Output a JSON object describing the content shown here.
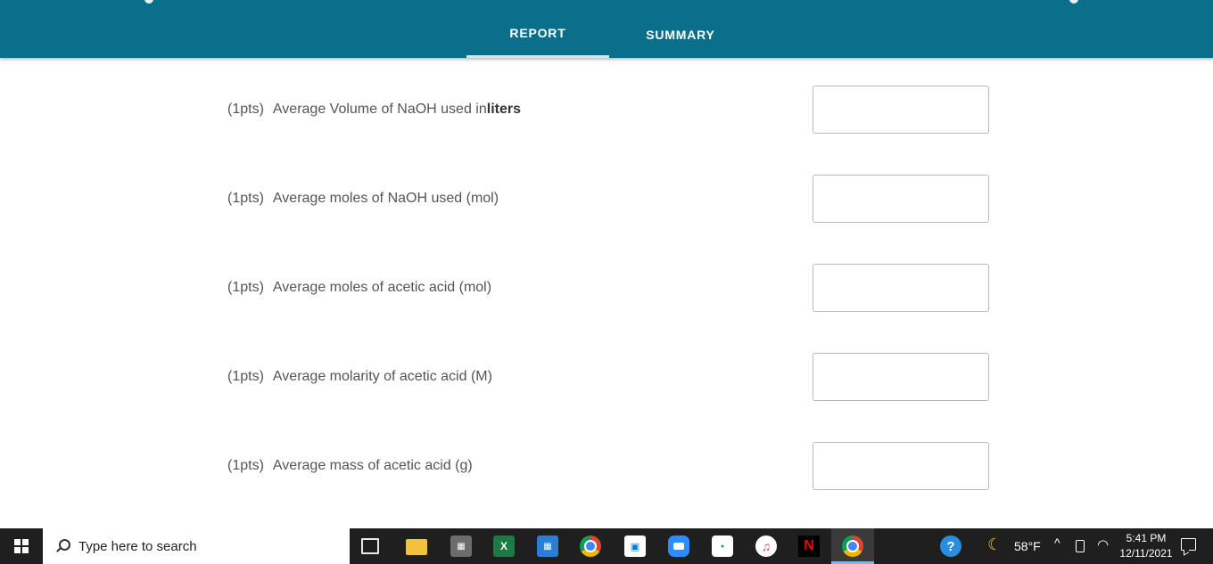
{
  "header": {
    "tabs": [
      {
        "label": "REPORT",
        "active": true
      },
      {
        "label": "SUMMARY",
        "active": false
      }
    ]
  },
  "questions": [
    {
      "points": "(1pts)",
      "label": "Average Volume of NaOH used in ",
      "label_bold": "liters",
      "value": ""
    },
    {
      "points": "(1pts)",
      "label": "Average moles of NaOH used (mol)",
      "value": ""
    },
    {
      "points": "(1pts)",
      "label": "Average moles of acetic acid (mol)",
      "value": ""
    },
    {
      "points": "(1pts)",
      "label": "Average molarity of acetic acid (M)",
      "value": ""
    },
    {
      "points": "(1pts)",
      "label": "Average mass of acetic acid (g)",
      "value": ""
    }
  ],
  "taskbar": {
    "search_placeholder": "Type here to search",
    "apps": [
      "task-view",
      "file-explorer",
      "calculator",
      "excel",
      "calendar",
      "chrome",
      "microsoft-store",
      "zoom",
      "cricut",
      "itunes",
      "netflix",
      "chrome-profile"
    ],
    "weather": "58°F",
    "time": "5:41 PM",
    "date": "12/11/2021"
  },
  "colors": {
    "header_bg": "#0b6f8c",
    "tab_underline": "#cfe7ef",
    "label_text": "#555555",
    "taskbar_bg": "#1f1f1f"
  }
}
